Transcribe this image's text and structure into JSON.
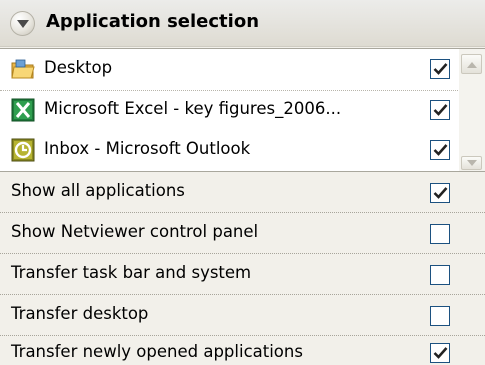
{
  "header": {
    "title": "Application selection",
    "collapse_icon": "chevron-up-icon"
  },
  "applications": [
    {
      "label": "Desktop",
      "icon": "folder-icon",
      "checked": true
    },
    {
      "label": "Microsoft Excel - key figures_2006...",
      "icon": "excel-icon",
      "checked": true
    },
    {
      "label": "Inbox - Microsoft Outlook",
      "icon": "outlook-icon",
      "checked": true
    }
  ],
  "options": [
    {
      "label": "Show all applications",
      "checked": true
    },
    {
      "label": "Show Netviewer control panel",
      "checked": false
    },
    {
      "label": "Transfer task bar and system",
      "checked": false
    },
    {
      "label": "Transfer desktop",
      "checked": false
    },
    {
      "label": "Transfer newly opened applications",
      "checked": true
    }
  ],
  "colors": {
    "checkbox_border": "#1c5180",
    "check_mark": "#21a121"
  }
}
